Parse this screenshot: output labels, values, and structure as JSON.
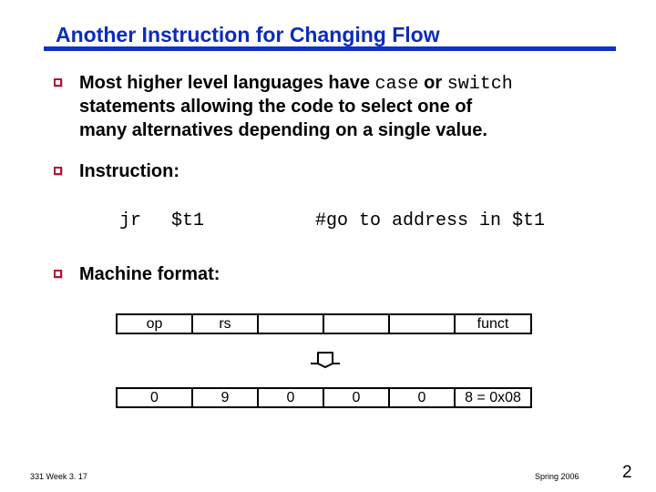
{
  "slide": {
    "title": "Another Instruction for Changing Flow",
    "colors": {
      "title": "#0b2db8",
      "bullet": "#b0163b"
    },
    "bullets": [
      {
        "icon": "square-bullet-icon",
        "line1_pre": "Most higher level languages have ",
        "code1": "case",
        "line1_mid": " or ",
        "code2": "switch",
        "line2": "statements allowing the code to select one of",
        "line3": "many alternatives depending on a single value."
      },
      {
        "icon": "square-bullet-icon",
        "text": "Instruction:"
      },
      {
        "icon": "square-bullet-icon",
        "text": "Machine format:"
      }
    ],
    "instruction": {
      "op": "jr",
      "operand": "$t1",
      "comment": "#go to address in $t1"
    },
    "machine_format": {
      "field_names": [
        "op",
        "rs",
        "",
        "",
        "",
        "funct"
      ],
      "field_values": [
        "0",
        "9",
        "0",
        "0",
        "0",
        "8 = 0x08"
      ],
      "arrow_icon": "down-arrow-icon"
    },
    "footer": {
      "course": "331  Week 3. 17",
      "term": "Spring 2006",
      "page": "2"
    }
  }
}
